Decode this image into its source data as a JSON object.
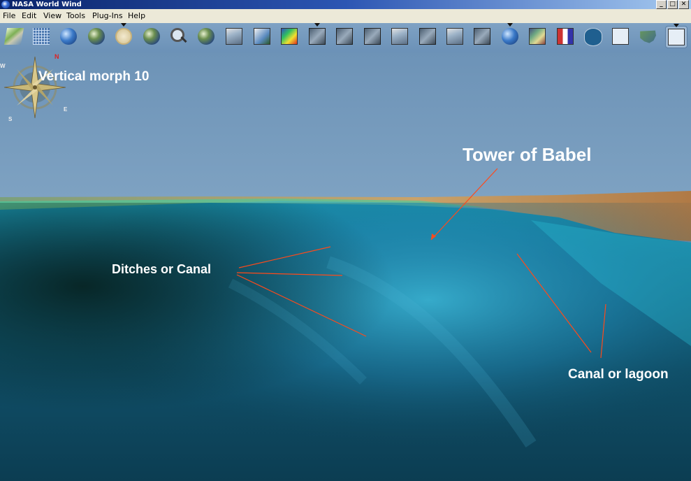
{
  "window": {
    "title": "NASA World Wind",
    "controls": {
      "minimize": "_",
      "maximize": "□",
      "close": "✕"
    }
  },
  "menu": {
    "items": [
      "File",
      "Edit",
      "View",
      "Tools",
      "Plug-Ins",
      "Help"
    ]
  },
  "toolbar": {
    "buttons": [
      "layer-manager-icon",
      "lat-lon-grid-icon",
      "globe-grid-icon",
      "blue-marble-icon",
      "compass-icon",
      "world-icon",
      "search-icon",
      "planets-icon",
      "usgs-map-icon",
      "wms-browser-icon",
      "scientific-data-icon",
      "landsat-icon-1",
      "landsat-icon-2",
      "landsat-icon-3",
      "landsat-icon-4",
      "landsat-icon-5",
      "landsat-icon-6",
      "landsat-icon-7",
      "globe-search-icon",
      "photo-layer-icon",
      "flags-icon",
      "landmarks-icon",
      "plane-icon",
      "usa-map-icon",
      "satellite-icon"
    ]
  },
  "annotations": {
    "morph": "Vertical morph 10",
    "babel": "Tower of Babel",
    "ditches": "Ditches or Canal",
    "canal": "Canal or lagoon"
  },
  "compass": {
    "north": "N",
    "east": "E",
    "south": "S",
    "west": "W"
  },
  "colors": {
    "sky": "#6f94b8",
    "water_shallow": "#2aa8c0",
    "water_deep": "#0a2e2e",
    "annotation_line": "#ff4a1a",
    "titlebar": "#0a246a"
  }
}
